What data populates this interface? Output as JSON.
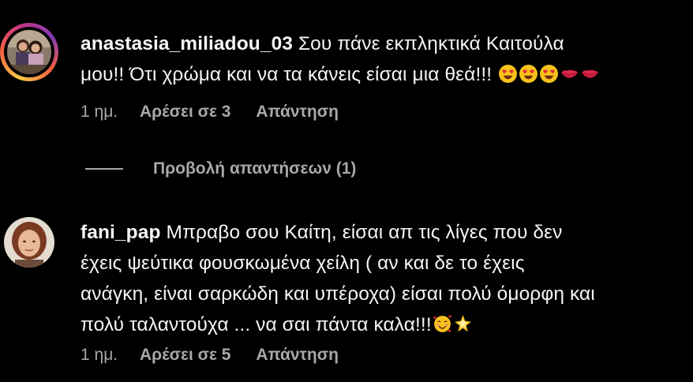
{
  "comments": [
    {
      "username": "anastasia_miliadou_03",
      "text_line1": " Σου πάνε εκπληκτικά Καιτούλα",
      "text_line2": "μου!! Ότι χρώμα και να τα κάνεις είσαι μια θεά!!! ",
      "emojis": [
        "heart-eyes-emoji",
        "heart-eyes-emoji",
        "heart-eyes-emoji",
        "kiss-mark-emoji",
        "kiss-mark-emoji"
      ],
      "time": "1 ημ.",
      "likes": "Αρέσει σε 3",
      "reply": "Απάντηση",
      "has_story_ring": true
    },
    {
      "username": "fani_pap",
      "text_line1": " Μπραβο σου Καίτη, είσαι απ τις λίγες που δεν",
      "text_line2": "έχεις ψεύτικα φουσκωμένα χείλη ( αν και δε το έχεις",
      "text_line3": "ανάγκη, είναι σαρκώδη και υπέροχα) είσαι πολύ όμορφη και",
      "text_line4": "πολύ ταλαντούχα ... να σαι πάντα καλα!!!",
      "emojis": [
        "smiling-face-with-hearts-emoji",
        "sparkle-star-emoji"
      ],
      "time": "1 ημ.",
      "likes": "Αρέσει σε 5",
      "reply": "Απάντηση",
      "has_story_ring": false
    }
  ],
  "view_replies": "Προβολή απαντήσεων (1)",
  "colors": {
    "background": "#000000",
    "text": "#f5f5f5",
    "secondary_text": "#a8a8a8"
  }
}
